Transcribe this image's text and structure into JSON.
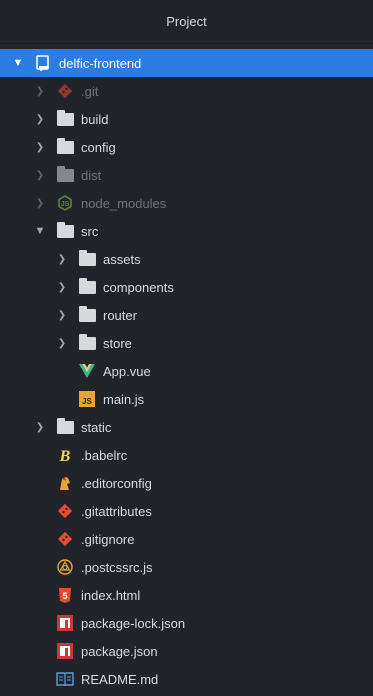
{
  "header": {
    "title": "Project"
  },
  "root": {
    "label": "delfic-frontend"
  },
  "items": [
    {
      "label": ".git"
    },
    {
      "label": "build"
    },
    {
      "label": "config"
    },
    {
      "label": "dist"
    },
    {
      "label": "node_modules"
    },
    {
      "label": "src"
    },
    {
      "label": "assets"
    },
    {
      "label": "components"
    },
    {
      "label": "router"
    },
    {
      "label": "store"
    },
    {
      "label": "App.vue"
    },
    {
      "label": "main.js"
    },
    {
      "label": "static"
    },
    {
      "label": ".babelrc"
    },
    {
      "label": ".editorconfig"
    },
    {
      "label": ".gitattributes"
    },
    {
      "label": ".gitignore"
    },
    {
      "label": ".postcssrc.js"
    },
    {
      "label": "index.html"
    },
    {
      "label": "package-lock.json"
    },
    {
      "label": "package.json"
    },
    {
      "label": "README.md"
    }
  ],
  "icon_text": {
    "js": "JS",
    "html": "5",
    "babel": "B"
  },
  "colors": {
    "selection": "#2c7ce4",
    "background": "#21252b",
    "git": "#e84d31",
    "node": "#8cc84b",
    "vue": "#41b883",
    "js": "#f0db4f",
    "html": "#e44d26",
    "npm": "#cb3837",
    "babel": "#f5da55"
  }
}
